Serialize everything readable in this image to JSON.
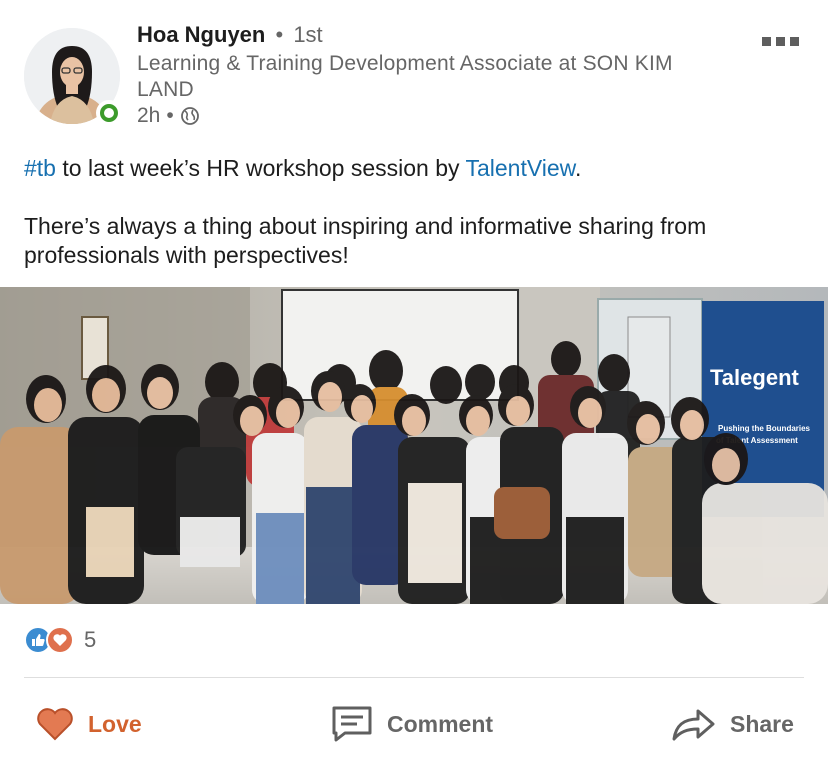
{
  "author": {
    "name": "Hoa Nguyen",
    "separator": "•",
    "degree": "1st",
    "headline": "Learning & Training Development Associate at SON KIM LAND",
    "time": "2h",
    "time_separator": "•",
    "visibility_icon": "globe-icon",
    "status_color": "#3c9b2b"
  },
  "post": {
    "hashtag": "#tb",
    "text_part1": " to last week’s HR workshop session by ",
    "mention": "TalentView",
    "text_part2": ".",
    "paragraph2": "There’s always a thing about inspiring and informative sharing from professionals with perspectives!",
    "link_color": "#1770b0"
  },
  "photo": {
    "banner_text": "Talegent",
    "banner_subtext_1": "Pushing the Boundaries",
    "banner_subtext_2": "of Talent Assessment"
  },
  "reactions": {
    "icons": [
      "like-icon",
      "love-icon"
    ],
    "count": "5"
  },
  "actions": {
    "love_label": "Love",
    "comment_label": "Comment",
    "share_label": "Share",
    "love_color": "#d2622e"
  },
  "menu": {
    "icon": "more-options-icon"
  }
}
